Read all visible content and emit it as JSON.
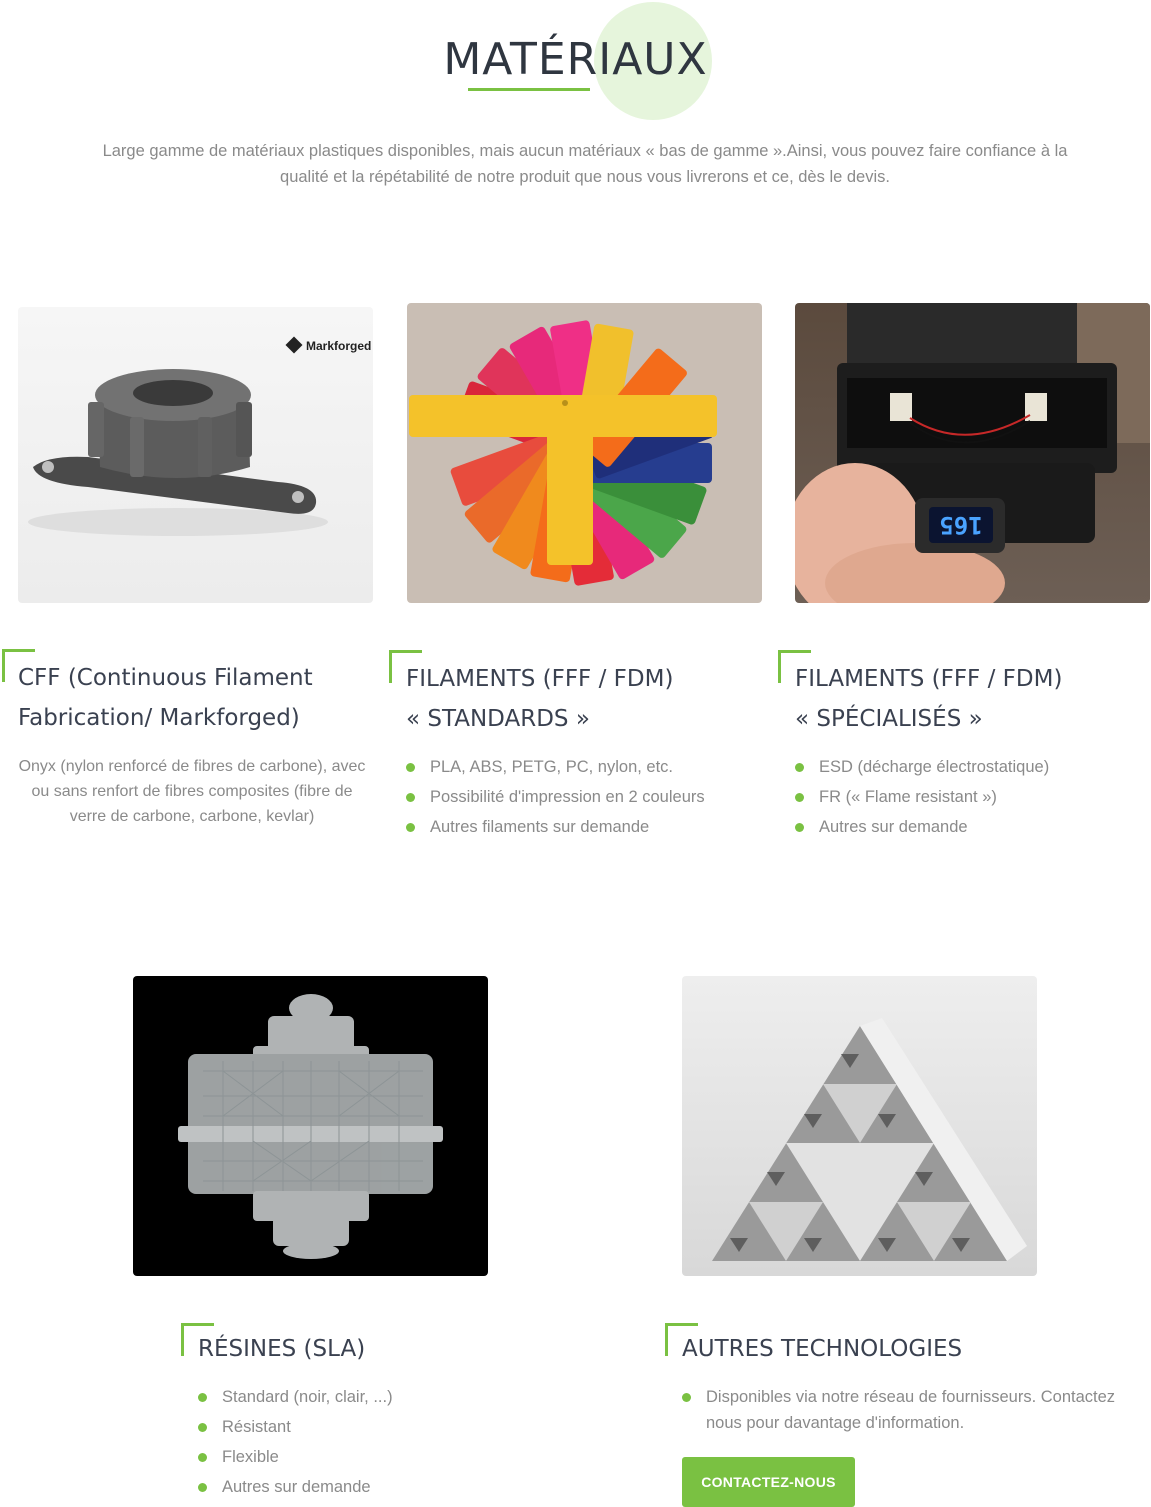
{
  "header": {
    "title": "MATÉRIAUX",
    "description": "Large gamme de matériaux plastiques disponibles, mais aucun matériaux « bas de gamme ».Ainsi, vous pouvez faire confiance à la qualité et la répétabilité de notre produit que nous vous livrerons et ce, dès le devis."
  },
  "cards": [
    {
      "title_line1": "CFF (Continuous Filament",
      "title_line2": "Fabrication/ Markforged)",
      "image_logo_text": "Markforged",
      "description": "Onyx (nylon renforcé de fibres de carbone), avec ou sans renfort de fibres composites (fibre de verre de carbone, carbone, kevlar)"
    },
    {
      "title_line1": "FILAMENTS (FFF / FDM)",
      "title_line2": "« STANDARDS »",
      "items": [
        "PLA, ABS, PETG, PC, nylon, etc.",
        "Possibilité d'impression en 2 couleurs",
        "Autres filaments sur demande"
      ]
    },
    {
      "title_line1": "FILAMENTS (FFF / FDM)",
      "title_line2": "« SPÉCIALISÉS »",
      "display_text": "165",
      "items": [
        "ESD (décharge électrostatique)",
        "FR (« Flame resistant »)",
        "Autres sur demande"
      ]
    },
    {
      "title_line1": "RÉSINES (SLA)",
      "items": [
        "Standard (noir, clair, ...)",
        "Résistant",
        "Flexible",
        "Autres sur demande"
      ]
    },
    {
      "title_line1": "AUTRES TECHNOLOGIES",
      "items": [
        "Disponibles via notre réseau de fournisseurs. Contactez nous pour davantage d'information."
      ],
      "button_label": "CONTACTEZ-NOUS"
    }
  ],
  "colors": {
    "accent": "#7ac142",
    "title": "#3a4150",
    "text": "#8a8a8a"
  }
}
